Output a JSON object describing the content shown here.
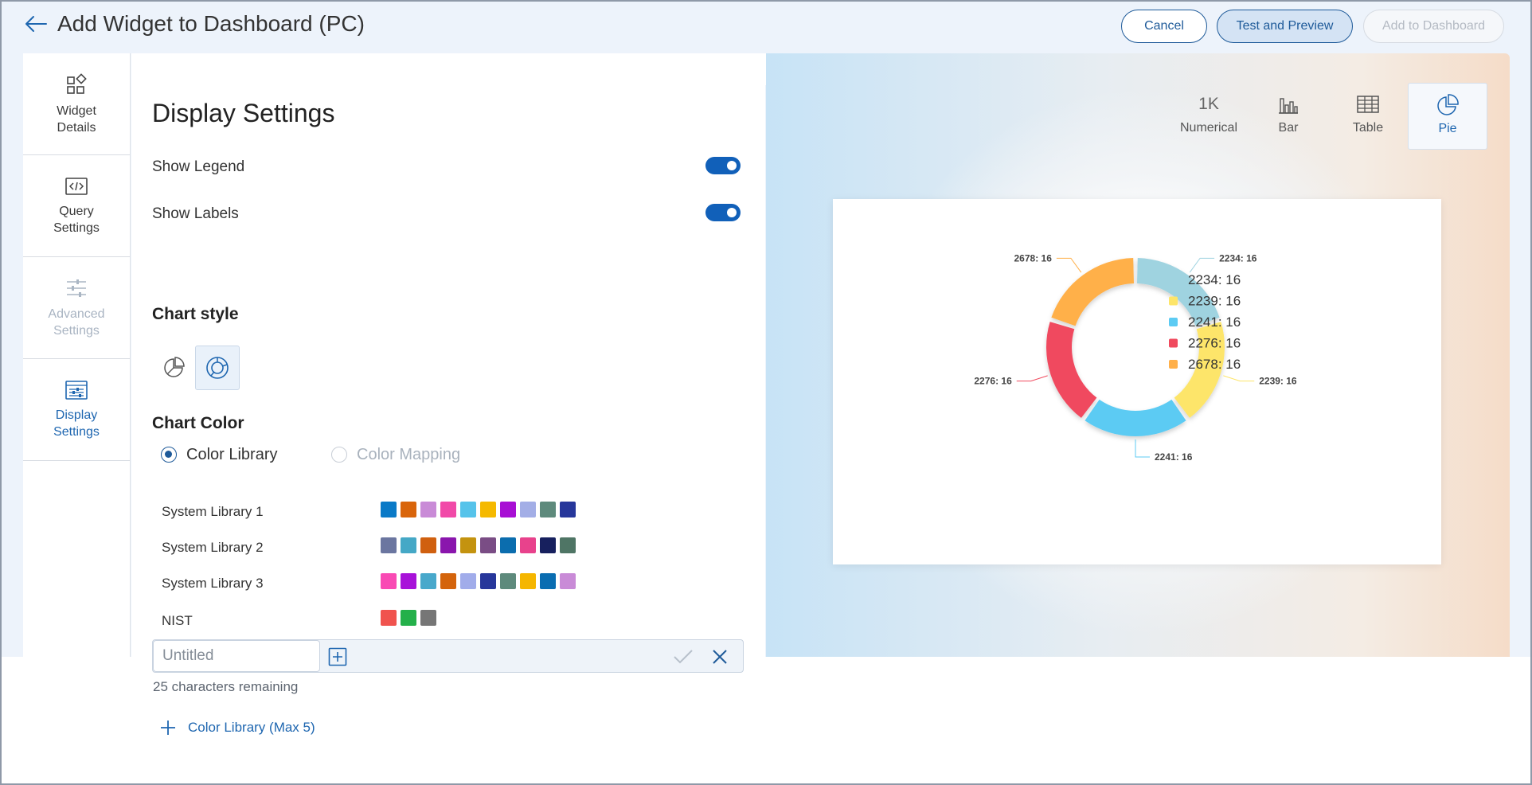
{
  "header": {
    "title": "Add Widget to Dashboard (PC)",
    "cancel_label": "Cancel",
    "test_label": "Test and Preview",
    "add_label": "Add to Dashboard"
  },
  "sidebar": {
    "items": [
      {
        "label1": "Widget",
        "label2": "Details",
        "icon": "widget-icon",
        "state": "normal"
      },
      {
        "label1": "Query",
        "label2": "Settings",
        "icon": "code-icon",
        "state": "normal"
      },
      {
        "label1": "Advanced",
        "label2": "Settings",
        "icon": "sliders-icon",
        "state": "disabled"
      },
      {
        "label1": "Display",
        "label2": "Settings",
        "icon": "display-settings-icon",
        "state": "active"
      }
    ]
  },
  "display": {
    "title": "Display Settings",
    "show_legend_label": "Show Legend",
    "show_legend": true,
    "show_labels_label": "Show Labels",
    "show_labels": true,
    "chart_style_label": "Chart style",
    "chart_style_selected": "donut",
    "chart_color_label": "Chart Color",
    "color_library_label": "Color Library",
    "color_mapping_label": "Color Mapping",
    "color_mode": "library",
    "libraries": [
      {
        "name": "System Library 1",
        "colors": [
          "#0a7ac7",
          "#d9650b",
          "#c98bd7",
          "#f14aa8",
          "#56c3ea",
          "#f5b900",
          "#a80fd4",
          "#a3aee6",
          "#5e8a7c",
          "#27379b"
        ]
      },
      {
        "name": "System Library 2",
        "colors": [
          "#6b76a0",
          "#45a8c6",
          "#d0600f",
          "#8a16ad",
          "#c4930f",
          "#7a4d85",
          "#0b6dae",
          "#e8428c",
          "#17205e",
          "#4f7565"
        ]
      },
      {
        "name": "System Library 3",
        "colors": [
          "#f94ab4",
          "#a812d9",
          "#48a8cb",
          "#d4640c",
          "#a1acea",
          "#27379b",
          "#5e8a7c",
          "#f5b600",
          "#0a6db1",
          "#c98bd7"
        ]
      },
      {
        "name": "NIST",
        "colors": [
          "#f0534e",
          "#24b04a",
          "#767676"
        ]
      }
    ],
    "new_library_placeholder": "Untitled",
    "chars_remaining": "25 characters remaining",
    "add_library_label": "Color Library (Max 5)"
  },
  "preview": {
    "tabs": [
      {
        "label": "Numerical",
        "icon_text": "1K"
      },
      {
        "label": "Bar",
        "icon_text": ""
      },
      {
        "label": "Table",
        "icon_text": ""
      },
      {
        "label": "Pie",
        "icon_text": ""
      }
    ],
    "active_tab": "Pie"
  },
  "chart_data": {
    "type": "pie",
    "style": "donut",
    "categories": [
      "2234",
      "2239",
      "2241",
      "2276",
      "2678"
    ],
    "values": [
      16,
      16,
      16,
      16,
      16
    ],
    "colors": [
      "#9fd3e0",
      "#fde56a",
      "#5ccbf3",
      "#f04a5e",
      "#ffb04a"
    ],
    "slice_labels": [
      "2234: 16",
      "2239: 16",
      "2241: 16",
      "2276: 16",
      "2678: 16"
    ],
    "legend": [
      "2234: 16",
      "2239: 16",
      "2241: 16",
      "2276: 16",
      "2678: 16"
    ],
    "legend_position": "right"
  }
}
